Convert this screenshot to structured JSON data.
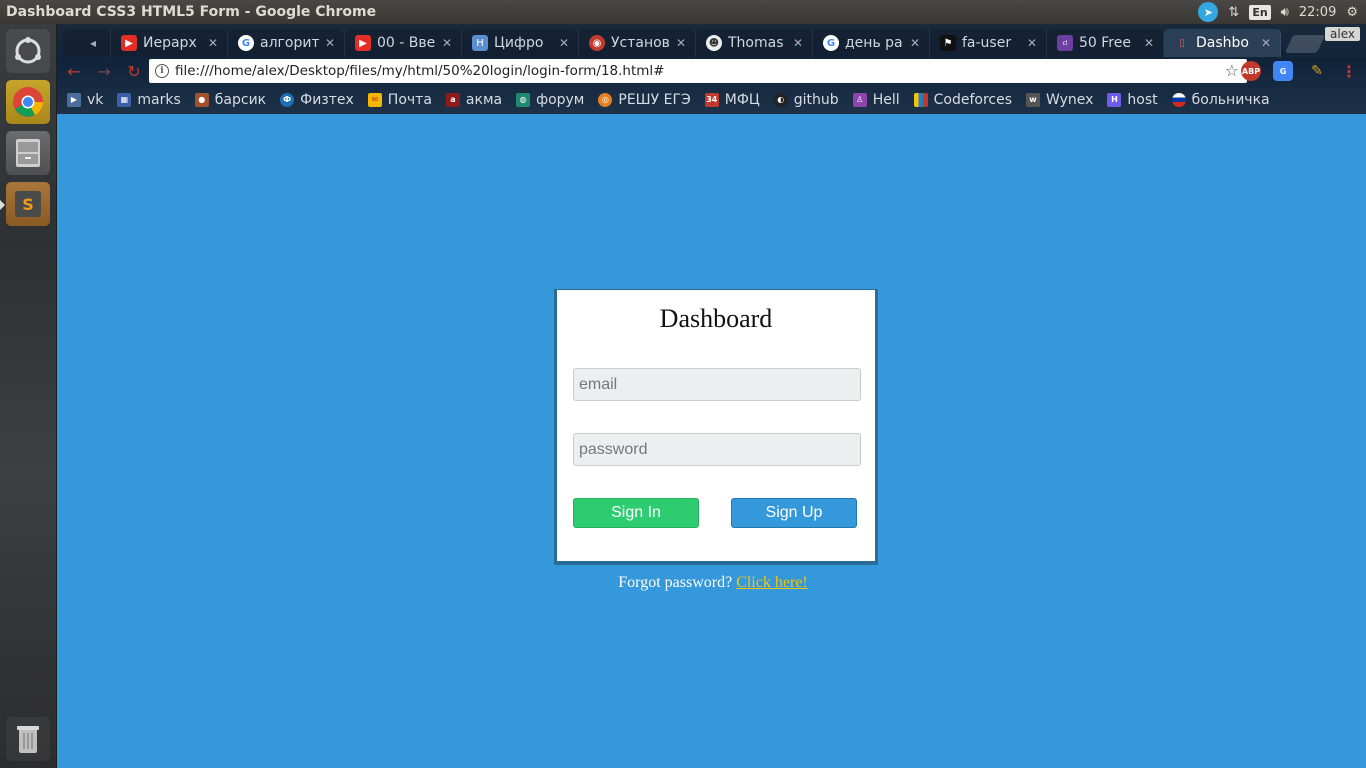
{
  "window": {
    "title": "Dashboard CSS3 HTML5 Form - Google Chrome",
    "clock": "22:09",
    "keyboard_lang": "En"
  },
  "tabs": [
    {
      "label": "Иерарх",
      "favicon": "youtube-icon",
      "color": "#e52d27"
    },
    {
      "label": "алгорит",
      "favicon": "google-icon",
      "color": "#4285f4"
    },
    {
      "label": "00 - Вве",
      "favicon": "youtube-icon",
      "color": "#e52d27"
    },
    {
      "label": "Цифро",
      "favicon": "h-letter-icon",
      "color": "#5b8fd0"
    },
    {
      "label": "Установ",
      "favicon": "debian-icon",
      "color": "#c23b2f"
    },
    {
      "label": "Thomas",
      "favicon": "avatar-icon",
      "color": "#333333"
    },
    {
      "label": "день ра",
      "favicon": "google-icon",
      "color": "#4285f4"
    },
    {
      "label": "fa-user",
      "favicon": "flag-icon",
      "color": "#111111"
    },
    {
      "label": "50 Free",
      "favicon": "colorlib-icon",
      "color": "#6c3fa0"
    },
    {
      "label": "Dashbo",
      "favicon": "file-icon",
      "color": "#ffffff",
      "active": true
    }
  ],
  "profile": "alex",
  "omnibox": {
    "url": "file:///home/alex/Desktop/files/my/html/50%20login/login-form/18.html#"
  },
  "extensions": [
    {
      "name": "adblock-icon",
      "label": "ABP",
      "color": "#c0392b"
    },
    {
      "name": "translate-icon",
      "label": "G",
      "color": "#4285f4"
    },
    {
      "name": "eyedropper-icon",
      "label": "",
      "color": "#d4a017"
    }
  ],
  "bookmarks": [
    {
      "label": "vk",
      "icon": "play-icon",
      "color": "#4a6d99"
    },
    {
      "label": "marks",
      "icon": "grid-icon",
      "color": "#3a5fa8"
    },
    {
      "label": "барсик",
      "icon": "cat-icon",
      "color": "#a0522d"
    },
    {
      "label": "Физтех",
      "icon": "phystech-icon",
      "color": "#1f6fb5"
    },
    {
      "label": "Почта",
      "icon": "mail-icon",
      "color": "#f5b800"
    },
    {
      "label": "акма",
      "icon": "akma-icon",
      "color": "#8e1b1b"
    },
    {
      "label": "форум",
      "icon": "forum-icon",
      "color": "#1f8a70"
    },
    {
      "label": "РЕШУ ЕГЭ",
      "icon": "ball-icon",
      "color": "#e67e22"
    },
    {
      "label": "МФЦ",
      "icon": "mfc-icon",
      "color": "#c0392b"
    },
    {
      "label": "github",
      "icon": "github-icon",
      "color": "#222222"
    },
    {
      "label": "Hell",
      "icon": "person-icon",
      "color": "#8e44ad"
    },
    {
      "label": "Codeforces",
      "icon": "codeforces-icon",
      "color": "#f1c40f"
    },
    {
      "label": "Wynex",
      "icon": "wynex-icon",
      "color": "#555555"
    },
    {
      "label": "host",
      "icon": "host-icon",
      "color": "#6c5ce7"
    },
    {
      "label": "больничка",
      "icon": "russia-flag-icon",
      "color": "#d52b1e"
    }
  ],
  "form": {
    "title": "Dashboard",
    "email_placeholder": "email",
    "password_placeholder": "password",
    "signin_label": "Sign In",
    "signup_label": "Sign Up",
    "forgot_text": "Forgot password?",
    "forgot_link": "Click here!"
  },
  "colors": {
    "page_bg": "#3498db",
    "signin": "#2ecc71",
    "signup": "#3498db",
    "link": "#f1c40f"
  }
}
